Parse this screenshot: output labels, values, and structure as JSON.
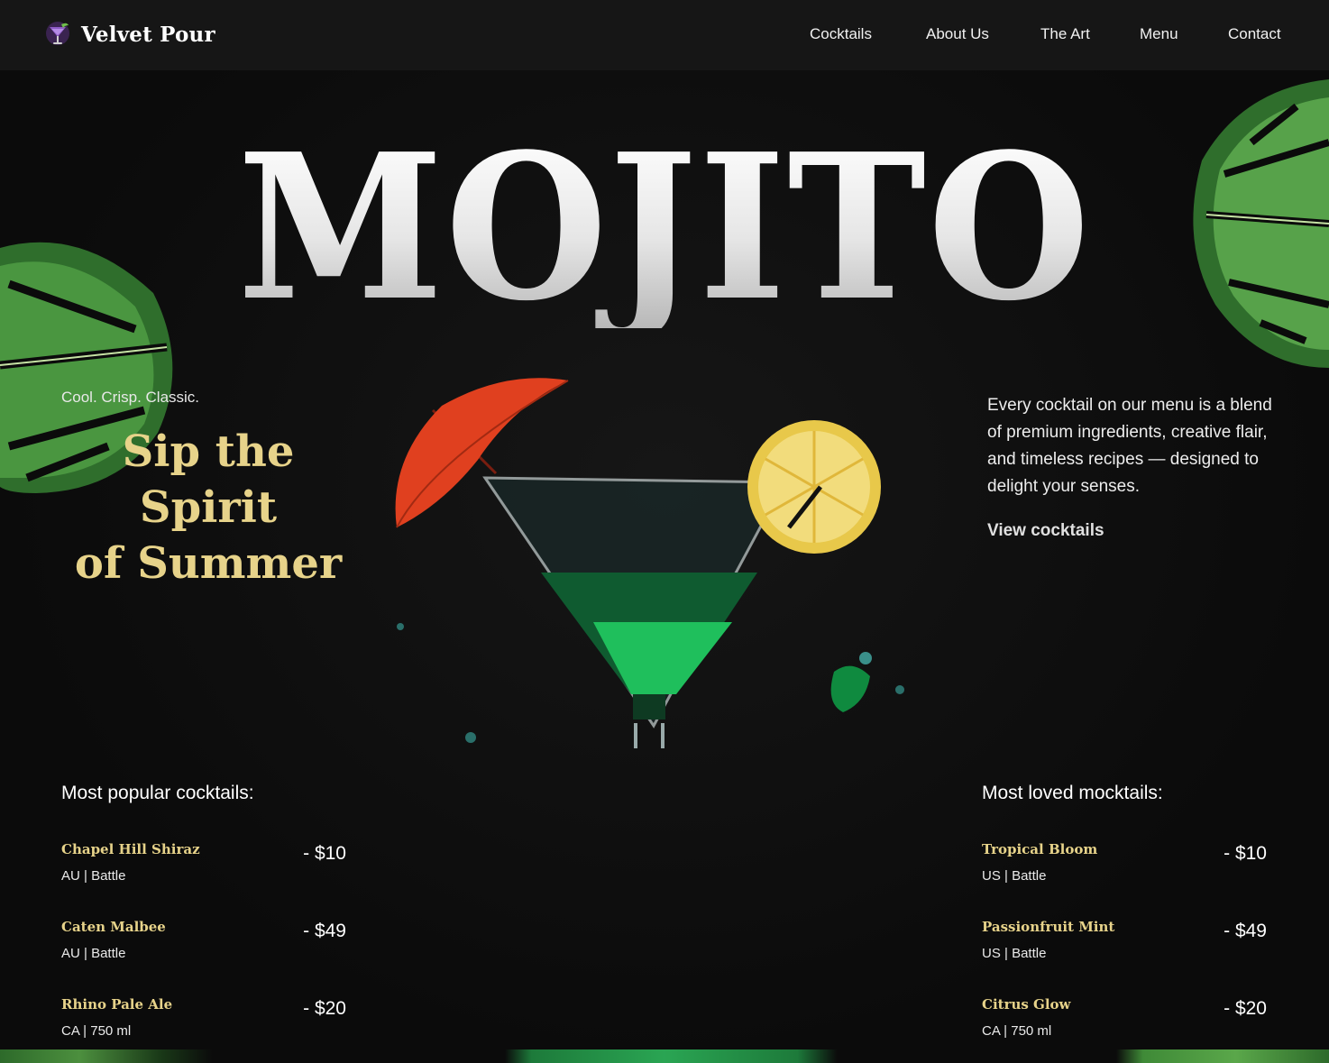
{
  "nav": {
    "brand": "Velvet Pour",
    "links": [
      "Cocktails",
      "About Us",
      "The Art",
      "Menu",
      "Contact"
    ]
  },
  "hero": {
    "title": "MOJITO",
    "tagline": "Cool. Crisp. Classic.",
    "headline_line1": "Sip the Spirit",
    "headline_line2": "of Summer",
    "blurb": "Every cocktail on our menu is a blend of premium ingredients, creative flair, and timeless recipes — designed to delight your senses.",
    "cta": "View cocktails"
  },
  "cocktails": {
    "title": "Most popular cocktails:",
    "items": [
      {
        "name": "Chapel Hill Shiraz",
        "meta": "AU | Battle",
        "price": "- $10"
      },
      {
        "name": "Caten Malbee",
        "meta": "AU | Battle",
        "price": "- $49"
      },
      {
        "name": "Rhino Pale Ale",
        "meta": "CA | 750 ml",
        "price": "- $20"
      }
    ]
  },
  "mocktails": {
    "title": "Most loved mocktails:",
    "items": [
      {
        "name": "Tropical Bloom",
        "meta": "US | Battle",
        "price": "- $10"
      },
      {
        "name": "Passionfruit Mint",
        "meta": "US | Battle",
        "price": "- $49"
      },
      {
        "name": "Citrus Glow",
        "meta": "CA | 750 ml",
        "price": "- $20"
      }
    ]
  },
  "icons": {
    "logo": "cocktail-glass-logo-icon",
    "leaf": "monstera-leaf-icon",
    "hero_image": "martini-glass-with-umbrella-and-lemon"
  },
  "colors": {
    "background": "#0c0c0c",
    "nav_background": "#161616",
    "accent_gold": "#e7d38a",
    "leaf_green": "#3f8a37",
    "drink_green": "#1fbf5c",
    "umbrella_red": "#e0401f",
    "lemon": "#e8c84a"
  }
}
